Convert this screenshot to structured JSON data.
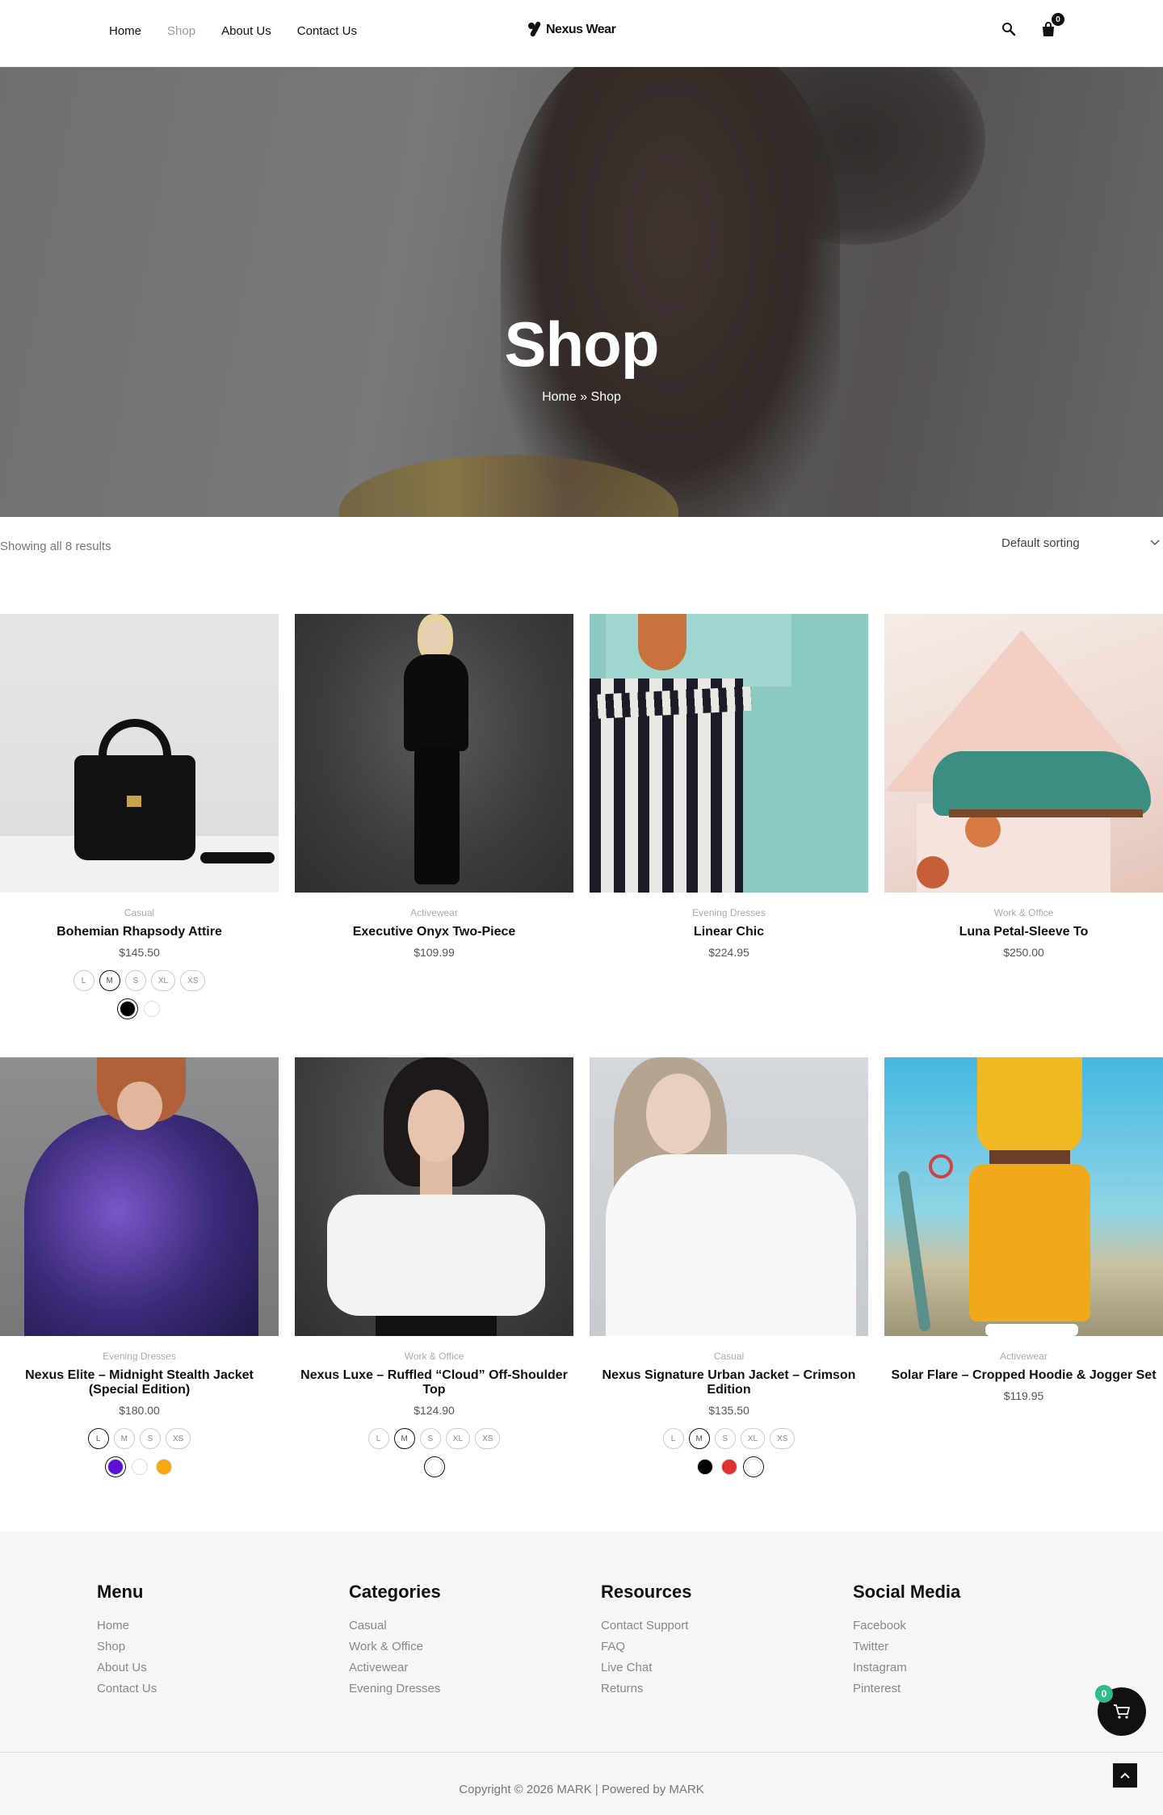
{
  "nav": {
    "items": [
      {
        "label": "Home",
        "active": false
      },
      {
        "label": "Shop",
        "active": true
      },
      {
        "label": "About Us",
        "active": false
      },
      {
        "label": "Contact Us",
        "active": false
      }
    ]
  },
  "brand": {
    "name": "Nexus Wear"
  },
  "header": {
    "cart_count": "0"
  },
  "hero": {
    "title": "Shop",
    "breadcrumb": "Home » Shop"
  },
  "toolbar": {
    "result_count": "Showing all 8 results",
    "sort_selected": "Default sorting"
  },
  "products": [
    {
      "category": "Casual",
      "title": "Bohemian Rhapsody Attire",
      "price": "$145.50",
      "sizes": [
        "L",
        "M",
        "S",
        "XL",
        "XS"
      ],
      "selected_size": "M",
      "colors": [
        "#000000",
        "#ffffff"
      ],
      "selected_color": 0
    },
    {
      "category": "Activewear",
      "title": "Executive Onyx Two-Piece",
      "price": "$109.99",
      "sizes": [],
      "colors": []
    },
    {
      "category": "Evening Dresses",
      "title": "Linear Chic",
      "price": "$224.95",
      "sizes": [],
      "colors": []
    },
    {
      "category": "Work & Office",
      "title": "Luna Petal-Sleeve To",
      "price": "$250.00",
      "sizes": [],
      "colors": []
    },
    {
      "category": "Evening Dresses",
      "title": "Nexus Elite – Midnight Stealth Jacket (Special Edition)",
      "price": "$180.00",
      "sizes": [
        "L",
        "M",
        "S",
        "XS"
      ],
      "selected_size": "L",
      "colors": [
        "#5b11d6",
        "#ffffff",
        "#f5a80f"
      ],
      "selected_color": 0
    },
    {
      "category": "Work & Office",
      "title": "Nexus Luxe – Ruffled “Cloud” Off-Shoulder Top",
      "price": "$124.90",
      "sizes": [
        "L",
        "M",
        "S",
        "XL",
        "XS"
      ],
      "selected_size": "M",
      "colors": [
        "#ffffff"
      ],
      "selected_color": 0
    },
    {
      "category": "Casual",
      "title": "Nexus Signature Urban Jacket – Crimson Edition",
      "price": "$135.50",
      "sizes": [
        "L",
        "M",
        "S",
        "XL",
        "XS"
      ],
      "selected_size": "M",
      "colors": [
        "#000000",
        "#e03131",
        "#ffffff"
      ],
      "selected_color": 2
    },
    {
      "category": "Activewear",
      "title": "Solar Flare – Cropped Hoodie & Jogger Set",
      "price": "$119.95",
      "sizes": [],
      "colors": []
    }
  ],
  "footer": {
    "menu": {
      "title": "Menu",
      "links": [
        "Home",
        "Shop",
        "About Us",
        "Contact Us"
      ]
    },
    "categories": {
      "title": "Categories",
      "links": [
        "Casual",
        "Work & Office",
        "Activewear",
        "Evening Dresses"
      ]
    },
    "resources": {
      "title": "Resources",
      "links": [
        "Contact Support",
        "FAQ",
        "Live Chat",
        "Returns"
      ]
    },
    "social": {
      "title": "Social Media",
      "links": [
        "Facebook",
        "Twitter",
        "Instagram",
        "Pinterest"
      ]
    },
    "copyright": "Copyright © 2026 MARK | Powered by MARK"
  },
  "floating_cart": {
    "count": "0"
  }
}
